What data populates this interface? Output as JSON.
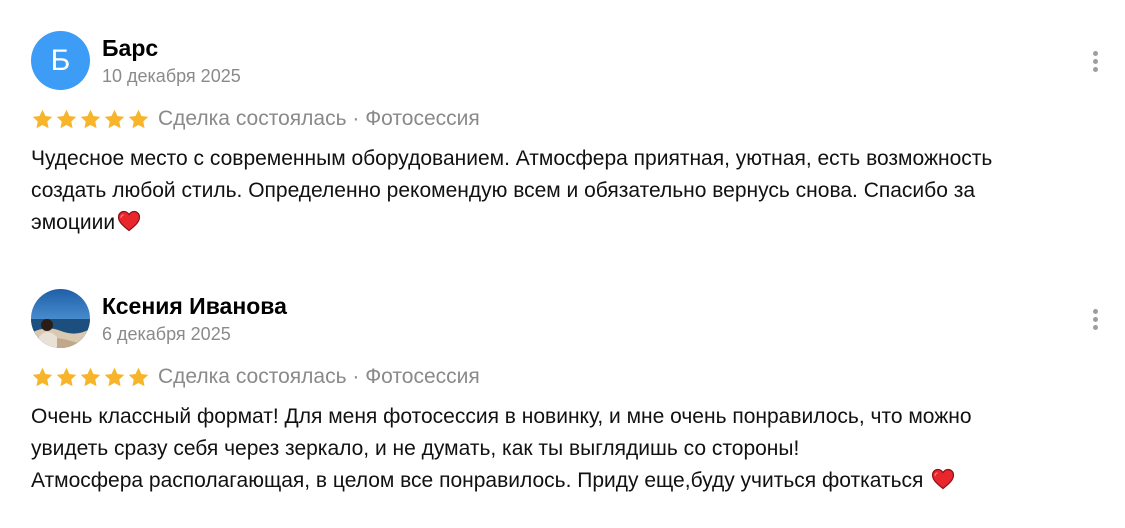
{
  "reviews": [
    {
      "avatar_letter": "Б",
      "author": "Барс",
      "date": "10 декабря 2025",
      "rating": 5,
      "meta": "Сделка состоялась · Фотосессия",
      "lines": [
        "Чудесное место с современным оборудованием. Атмосфера приятная, уютная, есть возможность",
        "создать любой стиль. Определенно рекомендую всем и обязательно вернусь снова. Спасибо за",
        "эмоциии"
      ]
    },
    {
      "author": "Ксения Иванова",
      "date": "6 декабря 2025",
      "rating": 5,
      "meta": "Сделка состоялась · Фотосессия",
      "lines": [
        "Очень классный формат! Для меня фотосессия в новинку, и мне очень понравилось, что можно",
        "увидеть сразу себя через зеркало, и не думать, как ты выглядишь со стороны!",
        "Атмосфера располагающая, в целом все понравилось. Приду еще,буду учиться фоткаться "
      ]
    }
  ],
  "colors": {
    "star": "#f7b52b",
    "avatar_bg": "#3d9cf5",
    "heart": "#e8262c",
    "meta_text": "#8a8a8a"
  },
  "icons": {
    "star": "star-icon",
    "heart": "heart-emoji",
    "menu": "more-vertical-icon"
  }
}
